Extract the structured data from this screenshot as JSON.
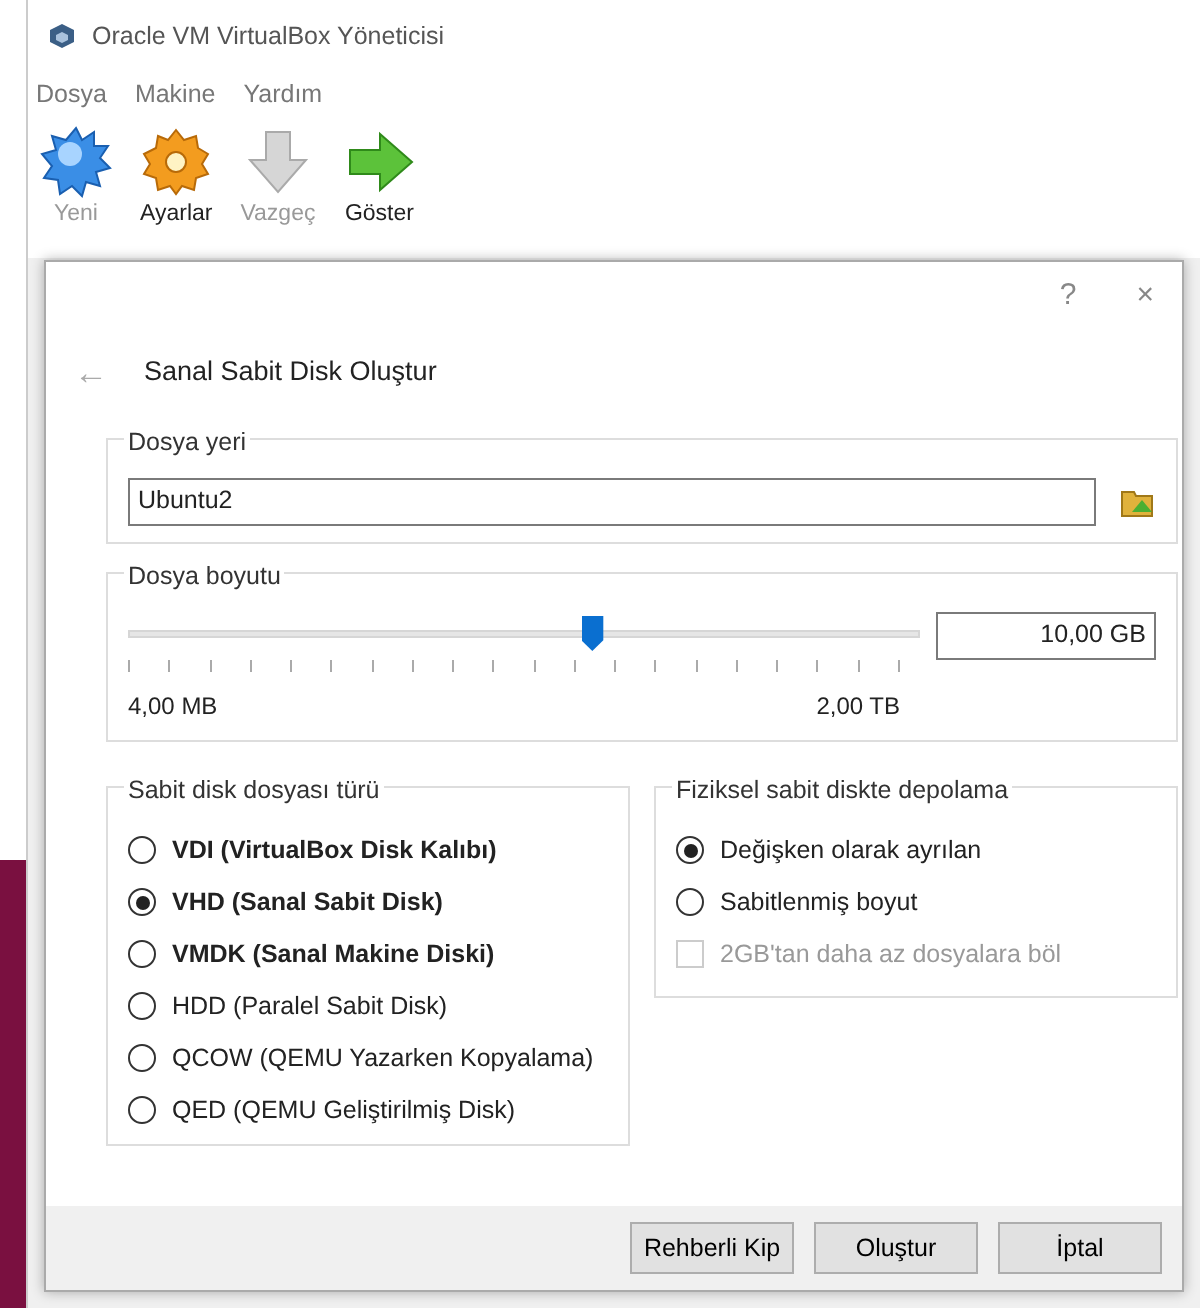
{
  "window": {
    "title": "Oracle VM VirtualBox Yöneticisi"
  },
  "menu": [
    "Dosya",
    "Makine",
    "Yardım"
  ],
  "toolbar": [
    {
      "label": "Yeni",
      "kind": "new",
      "disabled": true
    },
    {
      "label": "Ayarlar",
      "kind": "settings",
      "disabled": false
    },
    {
      "label": "Vazgeç",
      "kind": "discard",
      "disabled": true
    },
    {
      "label": "Göster",
      "kind": "show",
      "disabled": false
    }
  ],
  "dialog": {
    "help": "?",
    "close": "×",
    "back": "←",
    "title": "Sanal Sabit Disk Oluştur",
    "location": {
      "legend": "Dosya yeri",
      "value": "Ubuntu2"
    },
    "size": {
      "legend": "Dosya boyutu",
      "level": 0.585,
      "value": "10,00 GB",
      "min": "4,00 MB",
      "max": "2,00 TB"
    },
    "file_type": {
      "legend": "Sabit disk dosyası türü",
      "options": [
        {
          "label": "VDI (VirtualBox Disk Kalıbı)",
          "bold": true,
          "selected": false
        },
        {
          "label": "VHD (Sanal Sabit Disk)",
          "bold": true,
          "selected": true
        },
        {
          "label": "VMDK (Sanal Makine Diski)",
          "bold": true,
          "selected": false
        },
        {
          "label": "HDD (Paralel Sabit Disk)",
          "bold": false,
          "selected": false
        },
        {
          "label": "QCOW (QEMU Yazarken Kopyalama)",
          "bold": false,
          "selected": false
        },
        {
          "label": "QED (QEMU Geliştirilmiş Disk)",
          "bold": false,
          "selected": false
        }
      ]
    },
    "storage": {
      "legend": "Fiziksel sabit diskte depolama",
      "options": [
        {
          "label": "Değişken olarak ayrılan",
          "selected": true
        },
        {
          "label": "Sabitlenmiş boyut",
          "selected": false
        }
      ],
      "split": {
        "label": "2GB'tan daha az dosyalara böl",
        "checked": false,
        "disabled": true
      }
    },
    "buttons": [
      "Rehberli Kip",
      "Oluştur",
      "İptal"
    ]
  }
}
